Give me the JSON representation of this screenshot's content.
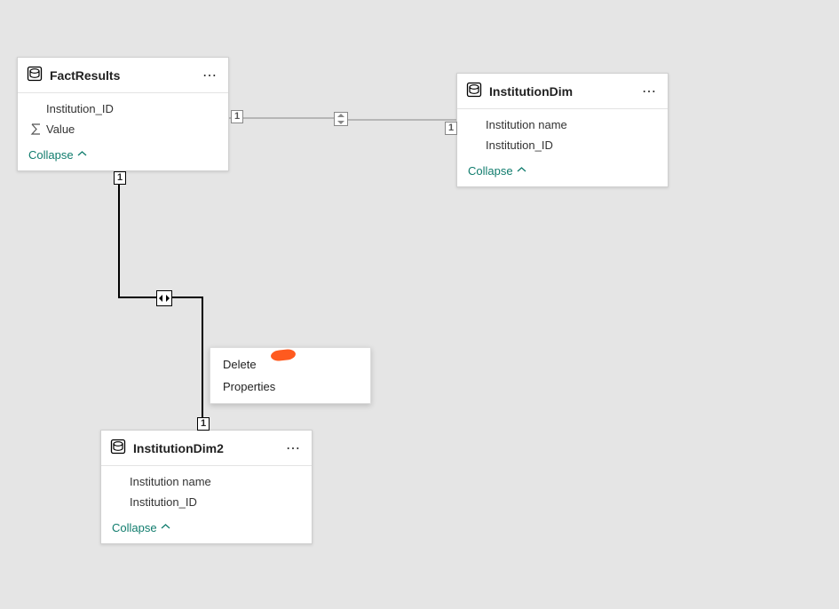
{
  "tables": {
    "factResults": {
      "title": "FactResults",
      "fields": [
        "Institution_ID",
        "Value"
      ],
      "collapse": "Collapse"
    },
    "institutionDim": {
      "title": "InstitutionDim",
      "fields": [
        "Institution name",
        "Institution_ID"
      ],
      "collapse": "Collapse"
    },
    "institutionDim2": {
      "title": "InstitutionDim2",
      "fields": [
        "Institution name",
        "Institution_ID"
      ],
      "collapse": "Collapse"
    }
  },
  "cardinality": {
    "fr_right": "1",
    "id_left": "1",
    "fr_bottom": "1",
    "id2_top": "1"
  },
  "contextMenu": {
    "delete": "Delete",
    "properties": "Properties"
  }
}
